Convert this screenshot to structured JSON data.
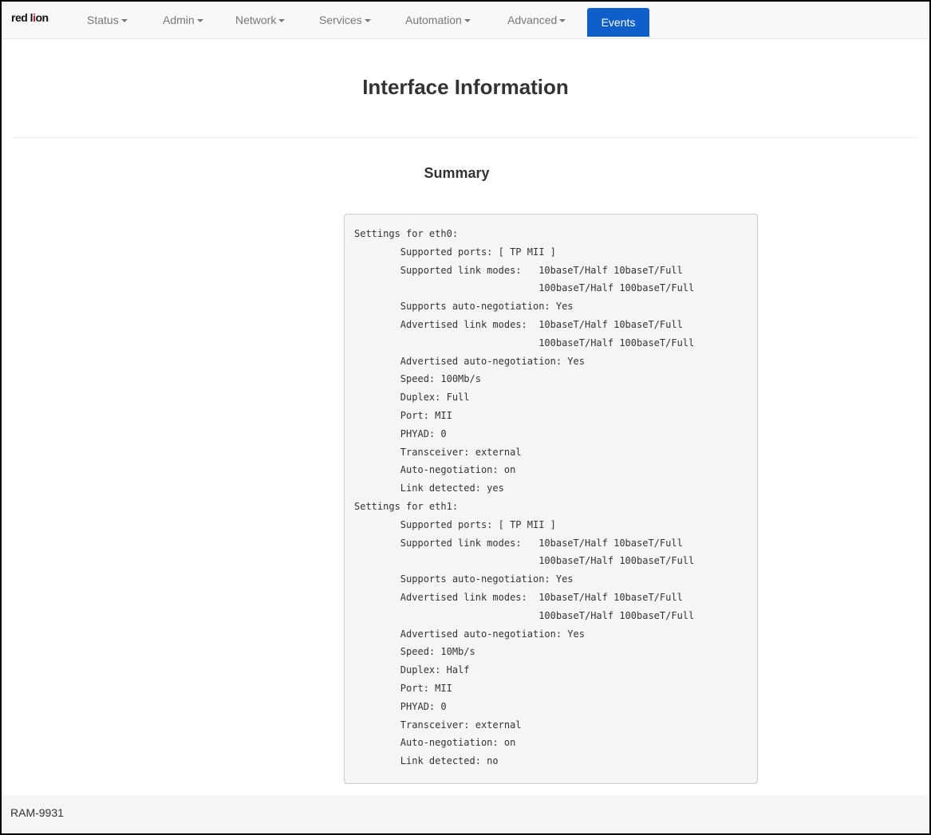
{
  "brand": {
    "logo_text_1": "red l",
    "logo_text_o": "i",
    "logo_text_2": "on"
  },
  "nav": {
    "items": [
      {
        "label": "Status"
      },
      {
        "label": "Admin"
      },
      {
        "label": "Network"
      },
      {
        "label": "Services"
      },
      {
        "label": "Automation"
      },
      {
        "label": "Advanced"
      }
    ],
    "active_label": "Events"
  },
  "page": {
    "title": "Interface Information",
    "section_title": "Summary",
    "output": "Settings for eth0:\n\tSupported ports: [ TP MII ]\n\tSupported link modes:   10baseT/Half 10baseT/Full \n\t                        100baseT/Half 100baseT/Full \n\tSupports auto-negotiation: Yes\n\tAdvertised link modes:  10baseT/Half 10baseT/Full \n\t                        100baseT/Half 100baseT/Full \n\tAdvertised auto-negotiation: Yes\n\tSpeed: 100Mb/s\n\tDuplex: Full\n\tPort: MII\n\tPHYAD: 0\n\tTransceiver: external\n\tAuto-negotiation: on\n\tLink detected: yes\nSettings for eth1:\n\tSupported ports: [ TP MII ]\n\tSupported link modes:   10baseT/Half 10baseT/Full \n\t                        100baseT/Half 100baseT/Full \n\tSupports auto-negotiation: Yes\n\tAdvertised link modes:  10baseT/Half 10baseT/Full \n\t                        100baseT/Half 100baseT/Full \n\tAdvertised auto-negotiation: Yes\n\tSpeed: 10Mb/s\n\tDuplex: Half\n\tPort: MII\n\tPHYAD: 0\n\tTransceiver: external\n\tAuto-negotiation: on\n\tLink detected: no"
  },
  "footer": {
    "text": "RAM-9931"
  },
  "colors": {
    "accent": "#0e5fc9",
    "brand_red": "#c8102e"
  }
}
